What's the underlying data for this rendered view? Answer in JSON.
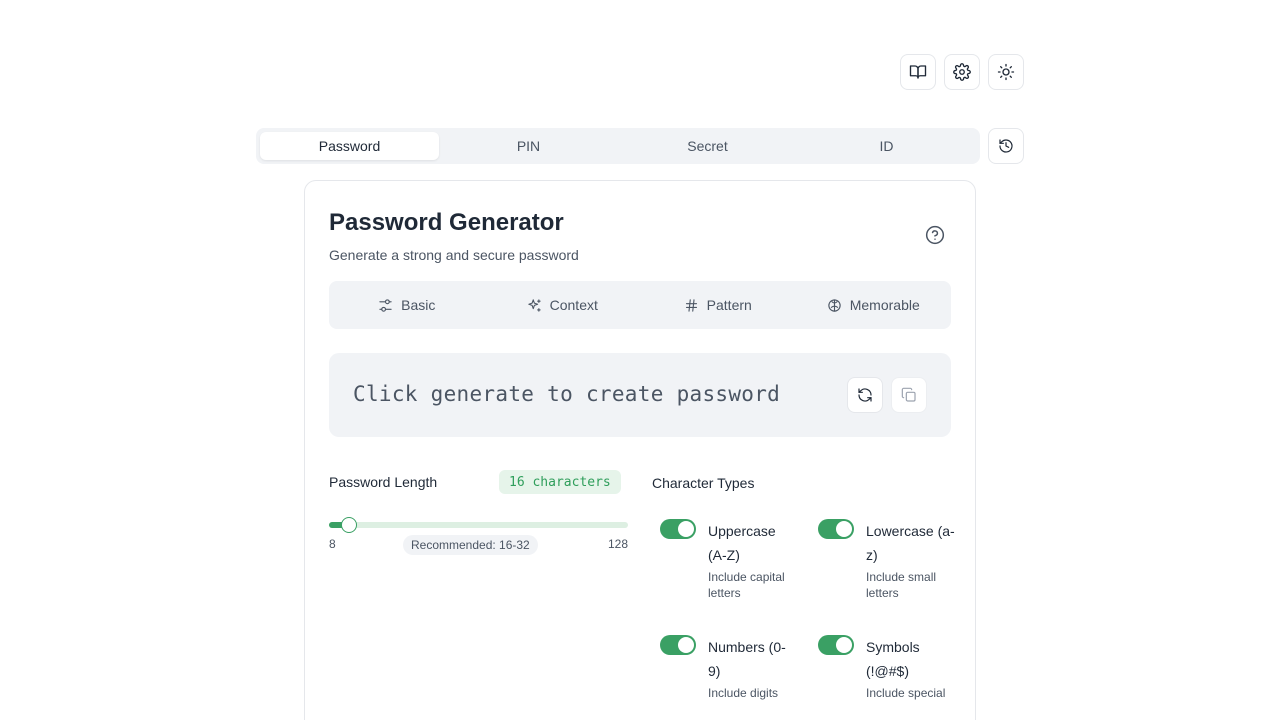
{
  "top_icons": [
    {
      "name": "docs",
      "icon": "book-open-icon"
    },
    {
      "name": "settings",
      "icon": "gear-icon"
    },
    {
      "name": "theme",
      "icon": "sun-icon"
    }
  ],
  "main_tabs": [
    {
      "label": "Password",
      "active": true
    },
    {
      "label": "PIN",
      "active": false
    },
    {
      "label": "Secret",
      "active": false
    },
    {
      "label": "ID",
      "active": false
    }
  ],
  "history_icon": "history-icon",
  "card": {
    "title": "Password Generator",
    "subtitle": "Generate a strong and secure password",
    "help_icon": "help-circle-icon"
  },
  "mode_tabs": [
    {
      "label": "Basic",
      "icon": "sliders-icon"
    },
    {
      "label": "Context",
      "icon": "sparkles-icon"
    },
    {
      "label": "Pattern",
      "icon": "hash-icon"
    },
    {
      "label": "Memorable",
      "icon": "brain-icon"
    }
  ],
  "output": {
    "placeholder": "Click generate to create password",
    "regenerate_icon": "refresh-icon",
    "copy_icon": "copy-icon"
  },
  "length": {
    "label": "Password Length",
    "badge": "16 characters",
    "value": 16,
    "min": 8,
    "max": 128,
    "min_label": "8",
    "max_label": "128",
    "recommended": "Recommended: 16-32"
  },
  "character_types": {
    "title": "Character Types",
    "accent": "#3aa064",
    "items": [
      {
        "name": "Uppercase (A-Z)",
        "desc": "Include capital letters",
        "enabled": true
      },
      {
        "name": "Lowercase (a-z)",
        "desc": "Include small letters",
        "enabled": true
      },
      {
        "name": "Numbers (0-9)",
        "desc": "Include digits",
        "enabled": true
      },
      {
        "name": "Symbols (!@#$)",
        "desc": "Include special",
        "enabled": true
      }
    ]
  }
}
